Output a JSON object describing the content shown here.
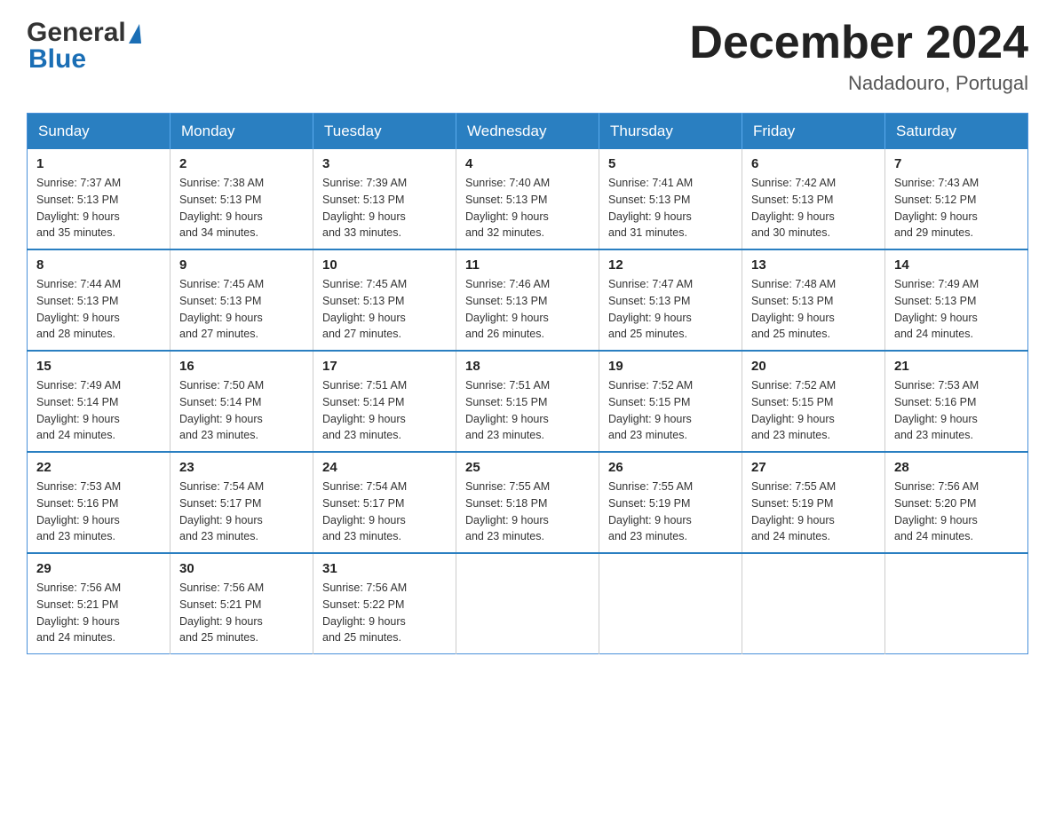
{
  "logo": {
    "line1": "General",
    "line2": "Blue"
  },
  "title": "December 2024",
  "subtitle": "Nadadouro, Portugal",
  "days_of_week": [
    "Sunday",
    "Monday",
    "Tuesday",
    "Wednesday",
    "Thursday",
    "Friday",
    "Saturday"
  ],
  "weeks": [
    [
      {
        "day": "1",
        "sunrise": "7:37 AM",
        "sunset": "5:13 PM",
        "daylight": "9 hours and 35 minutes."
      },
      {
        "day": "2",
        "sunrise": "7:38 AM",
        "sunset": "5:13 PM",
        "daylight": "9 hours and 34 minutes."
      },
      {
        "day": "3",
        "sunrise": "7:39 AM",
        "sunset": "5:13 PM",
        "daylight": "9 hours and 33 minutes."
      },
      {
        "day": "4",
        "sunrise": "7:40 AM",
        "sunset": "5:13 PM",
        "daylight": "9 hours and 32 minutes."
      },
      {
        "day": "5",
        "sunrise": "7:41 AM",
        "sunset": "5:13 PM",
        "daylight": "9 hours and 31 minutes."
      },
      {
        "day": "6",
        "sunrise": "7:42 AM",
        "sunset": "5:13 PM",
        "daylight": "9 hours and 30 minutes."
      },
      {
        "day": "7",
        "sunrise": "7:43 AM",
        "sunset": "5:12 PM",
        "daylight": "9 hours and 29 minutes."
      }
    ],
    [
      {
        "day": "8",
        "sunrise": "7:44 AM",
        "sunset": "5:13 PM",
        "daylight": "9 hours and 28 minutes."
      },
      {
        "day": "9",
        "sunrise": "7:45 AM",
        "sunset": "5:13 PM",
        "daylight": "9 hours and 27 minutes."
      },
      {
        "day": "10",
        "sunrise": "7:45 AM",
        "sunset": "5:13 PM",
        "daylight": "9 hours and 27 minutes."
      },
      {
        "day": "11",
        "sunrise": "7:46 AM",
        "sunset": "5:13 PM",
        "daylight": "9 hours and 26 minutes."
      },
      {
        "day": "12",
        "sunrise": "7:47 AM",
        "sunset": "5:13 PM",
        "daylight": "9 hours and 25 minutes."
      },
      {
        "day": "13",
        "sunrise": "7:48 AM",
        "sunset": "5:13 PM",
        "daylight": "9 hours and 25 minutes."
      },
      {
        "day": "14",
        "sunrise": "7:49 AM",
        "sunset": "5:13 PM",
        "daylight": "9 hours and 24 minutes."
      }
    ],
    [
      {
        "day": "15",
        "sunrise": "7:49 AM",
        "sunset": "5:14 PM",
        "daylight": "9 hours and 24 minutes."
      },
      {
        "day": "16",
        "sunrise": "7:50 AM",
        "sunset": "5:14 PM",
        "daylight": "9 hours and 23 minutes."
      },
      {
        "day": "17",
        "sunrise": "7:51 AM",
        "sunset": "5:14 PM",
        "daylight": "9 hours and 23 minutes."
      },
      {
        "day": "18",
        "sunrise": "7:51 AM",
        "sunset": "5:15 PM",
        "daylight": "9 hours and 23 minutes."
      },
      {
        "day": "19",
        "sunrise": "7:52 AM",
        "sunset": "5:15 PM",
        "daylight": "9 hours and 23 minutes."
      },
      {
        "day": "20",
        "sunrise": "7:52 AM",
        "sunset": "5:15 PM",
        "daylight": "9 hours and 23 minutes."
      },
      {
        "day": "21",
        "sunrise": "7:53 AM",
        "sunset": "5:16 PM",
        "daylight": "9 hours and 23 minutes."
      }
    ],
    [
      {
        "day": "22",
        "sunrise": "7:53 AM",
        "sunset": "5:16 PM",
        "daylight": "9 hours and 23 minutes."
      },
      {
        "day": "23",
        "sunrise": "7:54 AM",
        "sunset": "5:17 PM",
        "daylight": "9 hours and 23 minutes."
      },
      {
        "day": "24",
        "sunrise": "7:54 AM",
        "sunset": "5:17 PM",
        "daylight": "9 hours and 23 minutes."
      },
      {
        "day": "25",
        "sunrise": "7:55 AM",
        "sunset": "5:18 PM",
        "daylight": "9 hours and 23 minutes."
      },
      {
        "day": "26",
        "sunrise": "7:55 AM",
        "sunset": "5:19 PM",
        "daylight": "9 hours and 23 minutes."
      },
      {
        "day": "27",
        "sunrise": "7:55 AM",
        "sunset": "5:19 PM",
        "daylight": "9 hours and 24 minutes."
      },
      {
        "day": "28",
        "sunrise": "7:56 AM",
        "sunset": "5:20 PM",
        "daylight": "9 hours and 24 minutes."
      }
    ],
    [
      {
        "day": "29",
        "sunrise": "7:56 AM",
        "sunset": "5:21 PM",
        "daylight": "9 hours and 24 minutes."
      },
      {
        "day": "30",
        "sunrise": "7:56 AM",
        "sunset": "5:21 PM",
        "daylight": "9 hours and 25 minutes."
      },
      {
        "day": "31",
        "sunrise": "7:56 AM",
        "sunset": "5:22 PM",
        "daylight": "9 hours and 25 minutes."
      },
      null,
      null,
      null,
      null
    ]
  ],
  "labels": {
    "sunrise": "Sunrise:",
    "sunset": "Sunset:",
    "daylight": "Daylight:"
  }
}
